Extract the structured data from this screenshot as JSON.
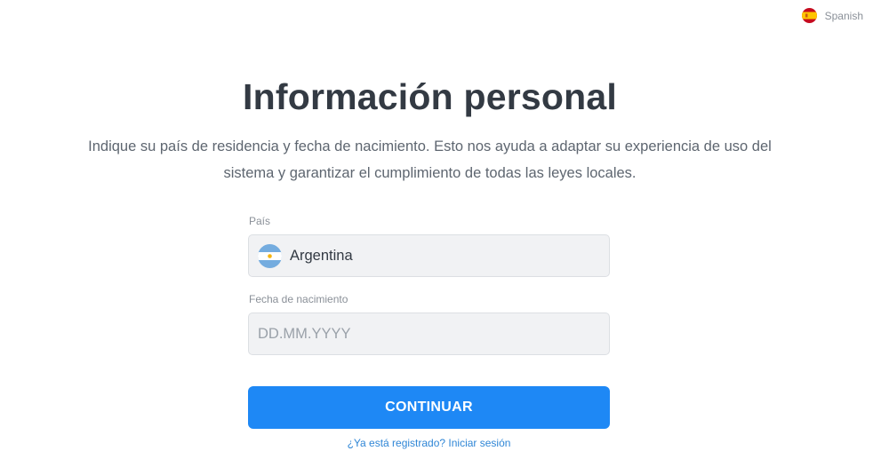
{
  "language": {
    "label": "Spanish",
    "flag_icon": "spain-flag-icon",
    "flag_colors": [
      "#c60b1e",
      "#ffc400"
    ]
  },
  "header": {
    "title": "Información personal",
    "subtitle": "Indique su país de residencia y fecha de nacimiento. Esto nos ayuda a adaptar su experiencia de uso del sistema y garantizar el cumplimiento de todas las leyes locales."
  },
  "form": {
    "country": {
      "label": "País",
      "value": "Argentina",
      "flag_icon": "argentina-flag-icon",
      "flag_colors": [
        "#74acdf",
        "#ffffff",
        "#f6b40e"
      ]
    },
    "birthdate": {
      "label": "Fecha de nacimiento",
      "placeholder": "DD.MM.YYYY",
      "value": ""
    },
    "continue_label": "CONTINUAR",
    "login_link": "¿Ya está registrado? Iniciar sesión"
  },
  "colors": {
    "primary": "#1e88f5",
    "link": "#2f86d6",
    "field_background": "#f1f2f4",
    "heading": "#333a43"
  }
}
